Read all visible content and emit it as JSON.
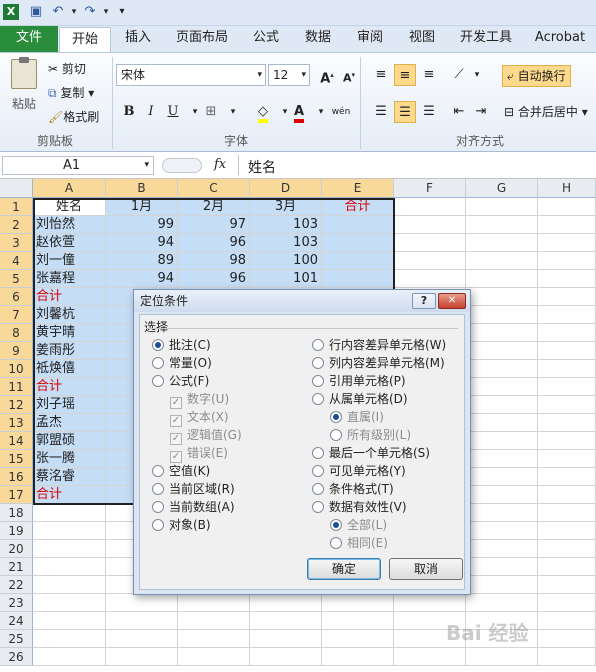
{
  "qat": {
    "app_icon": "excel-icon",
    "save_icon": "save-icon",
    "undo_icon": "undo-icon",
    "redo_icon": "redo-icon",
    "customize_icon": "customize-icon"
  },
  "tabs": [
    "文件",
    "开始",
    "插入",
    "页面布局",
    "公式",
    "数据",
    "审阅",
    "视图",
    "开发工具",
    "Acrobat"
  ],
  "ribbon": {
    "paste": "粘贴",
    "cut": "剪切",
    "copy": "复制",
    "format_painter": "格式刷",
    "clipboard_label": "剪贴板",
    "font_name": "宋体",
    "font_size": "12",
    "bold": "B",
    "italic": "I",
    "underline": "U",
    "phonetic": "wén",
    "font_label": "字体",
    "wrap_text": "自动换行",
    "merge_center": "合并后居中",
    "align_label": "对齐方式"
  },
  "formula_bar": {
    "name_box": "A1",
    "fx": "fx",
    "value": "姓名"
  },
  "columns": [
    "A",
    "B",
    "C",
    "D",
    "E",
    "F",
    "G",
    "H"
  ],
  "rows": [
    "1",
    "2",
    "3",
    "4",
    "5",
    "6",
    "7",
    "8",
    "9",
    "10",
    "11",
    "12",
    "13",
    "14",
    "15",
    "16",
    "17",
    "18",
    "19",
    "20",
    "21",
    "22",
    "23",
    "24",
    "25",
    "26"
  ],
  "cells": {
    "header": [
      "姓名",
      "1月",
      "2月",
      "3月",
      "合计"
    ],
    "data": [
      [
        "刘怡然",
        "99",
        "97",
        "103"
      ],
      [
        "赵依萱",
        "94",
        "96",
        "103"
      ],
      [
        "刘一僮",
        "89",
        "98",
        "100"
      ],
      [
        "张嘉程",
        "94",
        "96",
        "101"
      ],
      [
        "合计"
      ],
      [
        "刘馨杭"
      ],
      [
        "黄宇晴"
      ],
      [
        "姜雨彤"
      ],
      [
        "祗焕僖"
      ],
      [
        "合计"
      ],
      [
        "刘子瑶"
      ],
      [
        "孟杰"
      ],
      [
        "郭盟硕"
      ],
      [
        "张一腾"
      ],
      [
        "蔡洺睿"
      ],
      [
        "合计"
      ]
    ]
  },
  "dialog": {
    "title": "定位条件",
    "help": "?",
    "close": "✕",
    "group": "选择",
    "left_options": [
      "批注(C)",
      "常量(O)",
      "公式(F)"
    ],
    "formula_sub": [
      "数字(U)",
      "文本(X)",
      "逻辑值(G)",
      "错误(E)"
    ],
    "left_options2": [
      "空值(K)",
      "当前区域(R)",
      "当前数组(A)",
      "对象(B)"
    ],
    "right_options": [
      "行内容差异单元格(W)",
      "列内容差异单元格(M)",
      "引用单元格(P)",
      "从属单元格(D)"
    ],
    "dep_sub": [
      "直属(I)",
      "所有级别(L)"
    ],
    "right_options2": [
      "最后一个单元格(S)",
      "可见单元格(Y)",
      "条件格式(T)",
      "数据有效性(V)"
    ],
    "valid_sub": [
      "全部(L)",
      "相同(E)"
    ],
    "ok": "确定",
    "cancel": "取消"
  },
  "watermark": "Bai 经验",
  "colors": {
    "accent_green": "#2a8d3c",
    "selection_blue": "#c5ddf5",
    "red_text": "#e00000",
    "arrow_red": "#e00000"
  }
}
